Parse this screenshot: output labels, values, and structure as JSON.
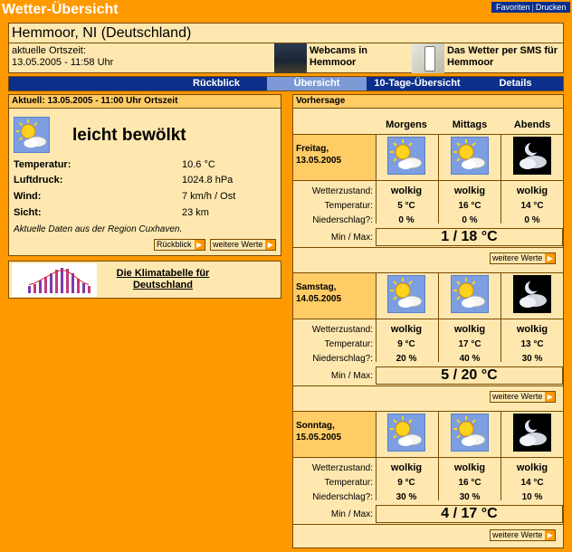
{
  "page": {
    "title": "Wetter-Übersicht"
  },
  "toplinks": {
    "favorites": "Favoriten",
    "print": "Drucken"
  },
  "location": {
    "name": "Hemmoor, NI (Deutschland)",
    "time_label": "aktuelle Ortszeit:",
    "time_value": "13.05.2005 - 11:58 Uhr",
    "webcams_line1": "Webcams in",
    "webcams_line2": "Hemmoor",
    "sms_line1": "Das Wetter per SMS für",
    "sms_line2": "Hemmoor"
  },
  "nav": {
    "tabs": [
      "Rückblick",
      "Übersicht",
      "10-Tage-Übersicht",
      "Details"
    ],
    "active": "Übersicht"
  },
  "current": {
    "header": "Aktuell: 13.05.2005 - 11:00 Uhr Ortszeit",
    "condition": "leicht bewölkt",
    "icon": "partly-cloudy-icon",
    "rows": [
      {
        "label": "Temperatur:",
        "value": "10.6 °C"
      },
      {
        "label": "Luftdruck:",
        "value": "1024.8 hPa"
      },
      {
        "label": "Wind:",
        "value": "7 km/h / Ost"
      },
      {
        "label": "Sicht:",
        "value": "23 km"
      }
    ],
    "note": "Aktuelle Daten aus der Region Cuxhaven.",
    "back_button": "Rückblick",
    "more_button": "weitere Werte"
  },
  "klima": {
    "line1": "Die Klimatabelle für",
    "line2": "Deutschland"
  },
  "forecast": {
    "header": "Vorhersage",
    "columns": [
      "Morgens",
      "Mittags",
      "Abends"
    ],
    "row_labels": {
      "condition": "Wetterzustand:",
      "temperature": "Temperatur:",
      "precip": "Niederschlag?:",
      "minmax": "Min / Max:"
    },
    "more_button": "weitere Werte",
    "days": [
      {
        "name": "Freitag,",
        "date": "13.05.2005",
        "icons": [
          "partly-cloudy-icon",
          "partly-cloudy-icon",
          "night-cloudy-icon"
        ],
        "conditions": [
          "wolkig",
          "wolkig",
          "wolkig"
        ],
        "temps": [
          "5 °C",
          "16 °C",
          "14 °C"
        ],
        "precip": [
          "0 %",
          "0 %",
          "0 %"
        ],
        "minmax": "1 / 18 °C"
      },
      {
        "name": "Samstag,",
        "date": "14.05.2005",
        "icons": [
          "partly-cloudy-icon",
          "partly-cloudy-icon",
          "night-cloudy-icon"
        ],
        "conditions": [
          "wolkig",
          "wolkig",
          "wolkig"
        ],
        "temps": [
          "9 °C",
          "17 °C",
          "13 °C"
        ],
        "precip": [
          "20 %",
          "40 %",
          "30 %"
        ],
        "minmax": "5 / 20 °C"
      },
      {
        "name": "Sonntag,",
        "date": "15.05.2005",
        "icons": [
          "partly-cloudy-icon",
          "partly-cloudy-icon",
          "night-cloudy-icon"
        ],
        "conditions": [
          "wolkig",
          "wolkig",
          "wolkig"
        ],
        "temps": [
          "9 °C",
          "16 °C",
          "14 °C"
        ],
        "precip": [
          "30 %",
          "30 %",
          "10 %"
        ],
        "minmax": "4 / 17 °C"
      }
    ]
  }
}
